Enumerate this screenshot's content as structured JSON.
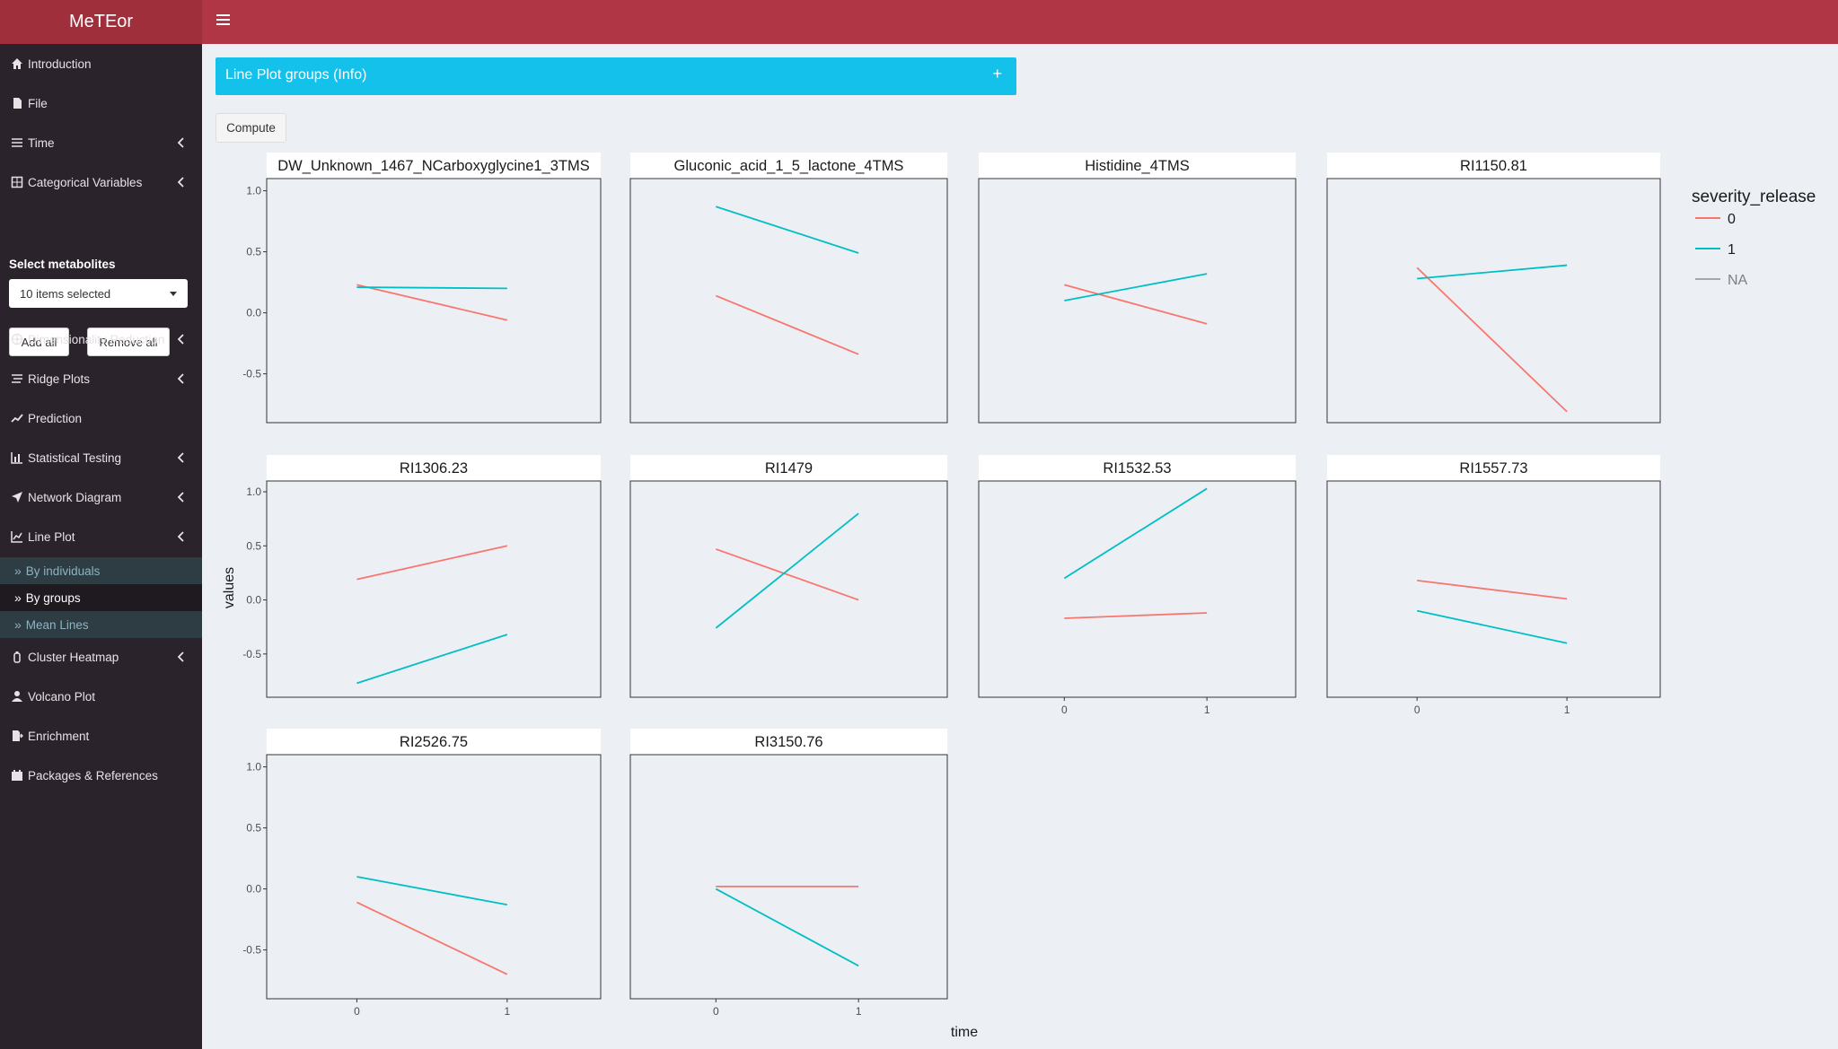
{
  "app": {
    "title": "MeTEor"
  },
  "sidebar": {
    "items": [
      {
        "label": "Introduction",
        "icon": "home-icon",
        "chevron": false
      },
      {
        "label": "File",
        "icon": "file-icon",
        "chevron": false
      },
      {
        "label": "Time",
        "icon": "sliders-icon",
        "chevron": true
      },
      {
        "label": "Categorical Variables",
        "icon": "table-icon",
        "chevron": true
      }
    ],
    "select_label": "Select metabolites",
    "picker_value": "10 items selected",
    "add_all": "Add all",
    "remove_all": "Remove all",
    "items2": [
      {
        "label": "Dimensionality Reduction",
        "icon": "dharma-wheel-icon",
        "chevron": true
      },
      {
        "label": "Ridge Plots",
        "icon": "stream-icon",
        "chevron": true
      },
      {
        "label": "Prediction",
        "icon": "trend-icon",
        "chevron": false
      },
      {
        "label": "Statistical Testing",
        "icon": "bar-chart-icon",
        "chevron": true
      },
      {
        "label": "Network Diagram",
        "icon": "paper-plane-icon",
        "chevron": true
      },
      {
        "label": "Line Plot",
        "icon": "line-chart-icon",
        "chevron": true
      }
    ],
    "subitems": [
      {
        "label": "By individuals",
        "active": false
      },
      {
        "label": "By groups",
        "active": true
      },
      {
        "label": "Mean Lines",
        "active": false
      }
    ],
    "items3": [
      {
        "label": "Cluster Heatmap",
        "icon": "bottle-icon",
        "chevron": true
      },
      {
        "label": "Volcano Plot",
        "icon": "user-icon",
        "chevron": false
      },
      {
        "label": "Enrichment",
        "icon": "file-export-icon",
        "chevron": false
      },
      {
        "label": "Packages & References",
        "icon": "calendar-icon",
        "chevron": false
      }
    ]
  },
  "main": {
    "info_title": "Line Plot groups (Info)",
    "info_toggle": "+",
    "compute_label": "Compute"
  },
  "colors": {
    "header": "#b03545",
    "logo": "#9e2f3b",
    "sidebar": "#2b232c",
    "info": "#14c1eb",
    "series0": "#f8766d",
    "series1": "#00bfc4",
    "seriesNA": "#a6a6a6"
  },
  "chart_data": {
    "type": "line",
    "xlabel": "time",
    "ylabel": "values",
    "ylim": [
      -0.9,
      1.1
    ],
    "yticks": [
      "1.0",
      "0.5",
      "0.0",
      "-0.5"
    ],
    "x": [
      "0",
      "1"
    ],
    "legend": {
      "title": "severity_release",
      "entries": [
        "0",
        "1",
        "NA"
      ],
      "position": "right"
    },
    "panels": [
      {
        "title": "DW_Unknown_1467_NCarboxyglycine1_3TMS",
        "series": [
          {
            "name": "0",
            "values": [
              0.23,
              -0.06
            ]
          },
          {
            "name": "1",
            "values": [
              0.21,
              0.2
            ]
          }
        ]
      },
      {
        "title": "Gluconic_acid_1_5_lactone_4TMS",
        "series": [
          {
            "name": "0",
            "values": [
              0.14,
              -0.34
            ]
          },
          {
            "name": "1",
            "values": [
              0.87,
              0.49
            ]
          }
        ]
      },
      {
        "title": "Histidine_4TMS",
        "series": [
          {
            "name": "0",
            "values": [
              0.23,
              -0.09
            ]
          },
          {
            "name": "1",
            "values": [
              0.1,
              0.32
            ]
          }
        ]
      },
      {
        "title": "RI1150.81",
        "series": [
          {
            "name": "0",
            "values": [
              0.37,
              -0.81
            ]
          },
          {
            "name": "1",
            "values": [
              0.28,
              0.39
            ]
          }
        ]
      },
      {
        "title": "RI1306.23",
        "series": [
          {
            "name": "0",
            "values": [
              0.19,
              0.5
            ]
          },
          {
            "name": "1",
            "values": [
              -0.77,
              -0.32
            ]
          }
        ]
      },
      {
        "title": "RI1479",
        "series": [
          {
            "name": "0",
            "values": [
              0.47,
              0.0
            ]
          },
          {
            "name": "1",
            "values": [
              -0.26,
              0.8
            ]
          }
        ]
      },
      {
        "title": "RI1532.53",
        "series": [
          {
            "name": "0",
            "values": [
              -0.17,
              -0.12
            ]
          },
          {
            "name": "1",
            "values": [
              0.2,
              1.03
            ]
          }
        ]
      },
      {
        "title": "RI1557.73",
        "series": [
          {
            "name": "0",
            "values": [
              0.18,
              0.01
            ]
          },
          {
            "name": "1",
            "values": [
              -0.1,
              -0.4
            ]
          }
        ]
      },
      {
        "title": "RI2526.75",
        "series": [
          {
            "name": "0",
            "values": [
              -0.11,
              -0.7
            ]
          },
          {
            "name": "1",
            "values": [
              0.1,
              -0.13
            ]
          }
        ]
      },
      {
        "title": "RI3150.76",
        "series": [
          {
            "name": "0",
            "values": [
              0.02,
              0.02
            ]
          },
          {
            "name": "1",
            "values": [
              0.0,
              -0.63
            ]
          }
        ]
      }
    ]
  }
}
